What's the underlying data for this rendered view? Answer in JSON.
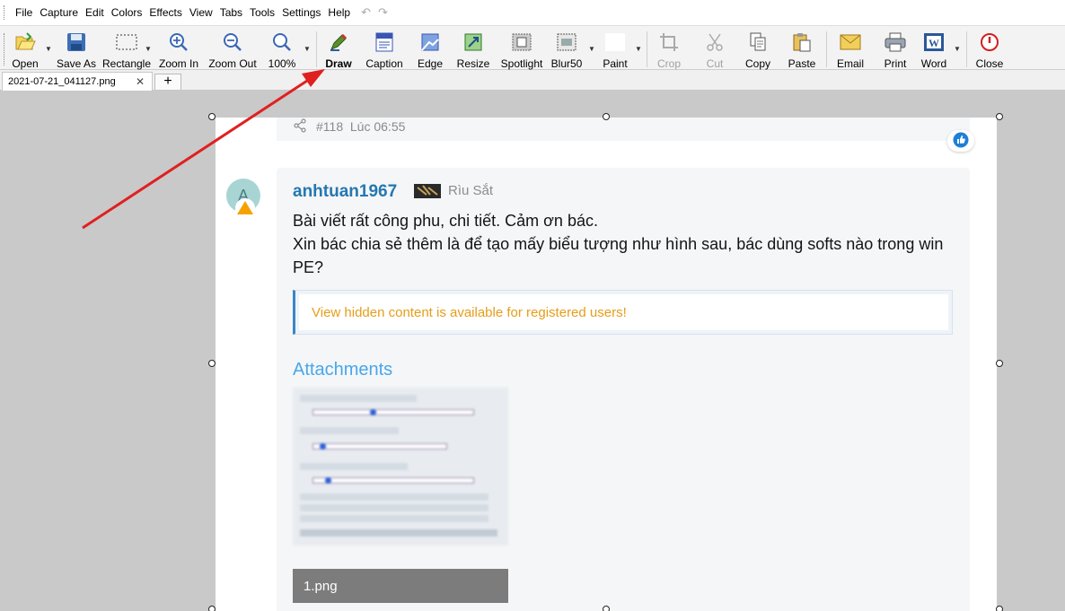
{
  "menu": [
    "File",
    "Capture",
    "Edit",
    "Colors",
    "Effects",
    "View",
    "Tabs",
    "Tools",
    "Settings",
    "Help"
  ],
  "toolbar": {
    "open": "Open",
    "save_as": "Save As",
    "rectangle": "Rectangle",
    "zoom_in": "Zoom In",
    "zoom_out": "Zoom Out",
    "zoom_level": "100%",
    "draw": "Draw",
    "caption": "Caption",
    "edge": "Edge",
    "resize": "Resize",
    "spotlight": "Spotlight",
    "blur": "Blur50",
    "paint": "Paint",
    "crop": "Crop",
    "cut": "Cut",
    "copy": "Copy",
    "paste": "Paste",
    "email": "Email",
    "print": "Print",
    "word": "Word",
    "close": "Close"
  },
  "tabs": {
    "doc_tab": "2021-07-21_041127.png",
    "close_glyph": "✕",
    "add_glyph": "+"
  },
  "post": {
    "post_number": "#118",
    "time": "Lúc 06:55",
    "avatar_letter": "A",
    "username": "anhtuan1967",
    "user_title": "Rìu Sắt",
    "line1": "Bài viết rất công phu, chi tiết. Cảm ơn bác.",
    "line2": "Xin bác chia sẻ thêm là để tạo mấy biểu tượng như hình sau, bác dùng softs nào trong win PE?",
    "hidden_notice": "View hidden content is available for registered users!",
    "attachments_heading": "Attachments",
    "attachment_name": "1.png"
  },
  "colors": {
    "annotation_arrow": "#e02020",
    "username": "#2577b1",
    "hidden_notice": "#e69d1a",
    "attachments_heading": "#47a7eb",
    "close_icon": "#d32020"
  }
}
